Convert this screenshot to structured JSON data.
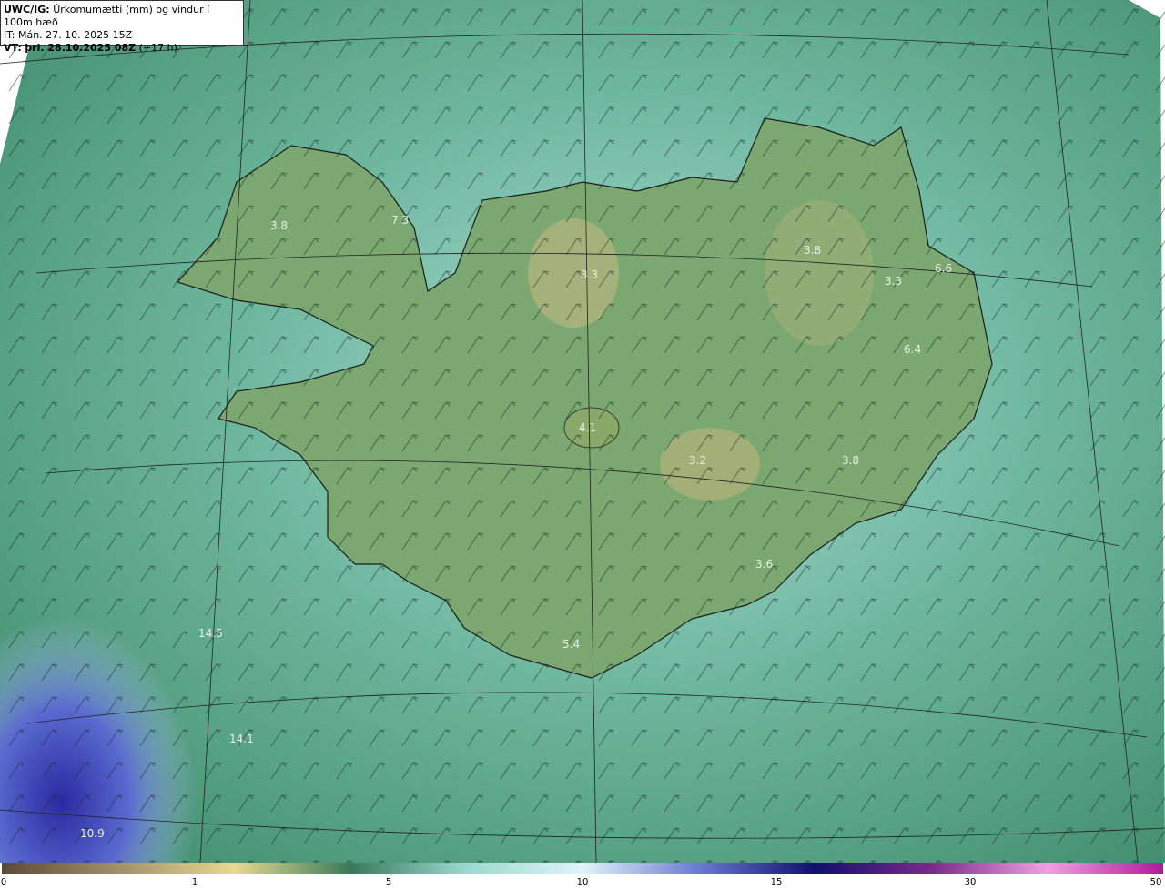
{
  "header": {
    "model": "UWC/IG:",
    "title": "Úrkomumætti (mm) og vindur í 100m hæð",
    "init_time": "IT: Mán. 27. 10. 2025 15Z",
    "valid_prefix": "VT:",
    "valid_time": "þri. 28.10.2025 08Z",
    "lead": "(+17 h)"
  },
  "map_labels": [
    {
      "id": "wf1",
      "text": "3.8"
    },
    {
      "id": "wf2",
      "text": "7.3"
    },
    {
      "id": "n1",
      "text": "3.3"
    },
    {
      "id": "ne1",
      "text": "3.8"
    },
    {
      "id": "e1",
      "text": "6.6"
    },
    {
      "id": "e2",
      "text": "3.3"
    },
    {
      "id": "e3",
      "text": "6.4"
    },
    {
      "id": "c1",
      "text": "4.1"
    },
    {
      "id": "v1",
      "text": "3.2"
    },
    {
      "id": "v2",
      "text": "3.8"
    },
    {
      "id": "s1",
      "text": "3.6"
    },
    {
      "id": "s2",
      "text": "5.4"
    },
    {
      "id": "sw1",
      "text": "14.5"
    },
    {
      "id": "sw2",
      "text": "14.1"
    },
    {
      "id": "sw3",
      "text": "10.9"
    }
  ],
  "colorbar": {
    "ticks": [
      "0",
      "1",
      "5",
      "10",
      "15",
      "30",
      "50"
    ],
    "colors": [
      "#5a4a3a",
      "#a0906a",
      "#e8d890",
      "#3a7a5a",
      "#9ad8d0",
      "#e0f4fa",
      "#6a7ad0",
      "#10106a",
      "#7a2a8a",
      "#f0a0e0",
      "#b01a9a"
    ]
  },
  "colors": {
    "sea": "#3f8a6a",
    "land": "#7aa870",
    "heavy_precip": "#3a40b0",
    "coast": "#1a1a1a"
  }
}
